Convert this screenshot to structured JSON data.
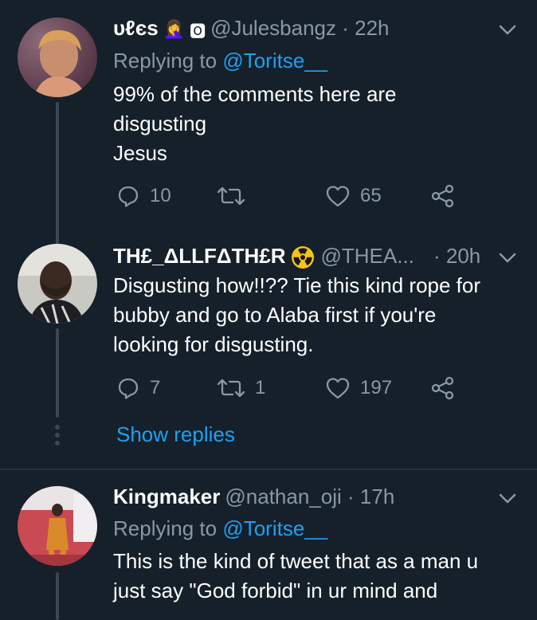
{
  "tweets": [
    {
      "name": "ᴜℓєѕ",
      "emoji_1": "🤦‍♀️",
      "emoji_2": "🅾",
      "handle": "@Julesbangz",
      "time": "· 22h",
      "replying_label": "Replying to",
      "replying_handle": "@Toritse__",
      "text_lines": [
        "99% of the comments here are",
        "disgusting",
        "Jesus"
      ],
      "reply_count": "10",
      "retweet_count": "",
      "like_count": "65"
    },
    {
      "name": "TH£_ΔLLFΔTH£R",
      "emoji_1": "☢",
      "handle": "@THEA...",
      "time": "· 20h",
      "text_lines": [
        "Disgusting how!!?? Tie this kind rope for",
        "bubby and go to Alaba first if you're",
        "looking for disgusting."
      ],
      "reply_count": "7",
      "retweet_count": "1",
      "like_count": "197",
      "show_replies": "Show replies"
    },
    {
      "name": "Kingmaker",
      "handle": "@nathan_oji",
      "time": "· 17h",
      "replying_label": "Replying to",
      "replying_handle": "@Toritse__",
      "text_lines": [
        "This is the kind of tweet that as a man u",
        "just say \"God forbid\" in ur mind and"
      ]
    }
  ],
  "colors": {
    "background": "#15202b",
    "secondary_text": "#8899a6",
    "link": "#1da1f2",
    "divider": "#243340"
  }
}
